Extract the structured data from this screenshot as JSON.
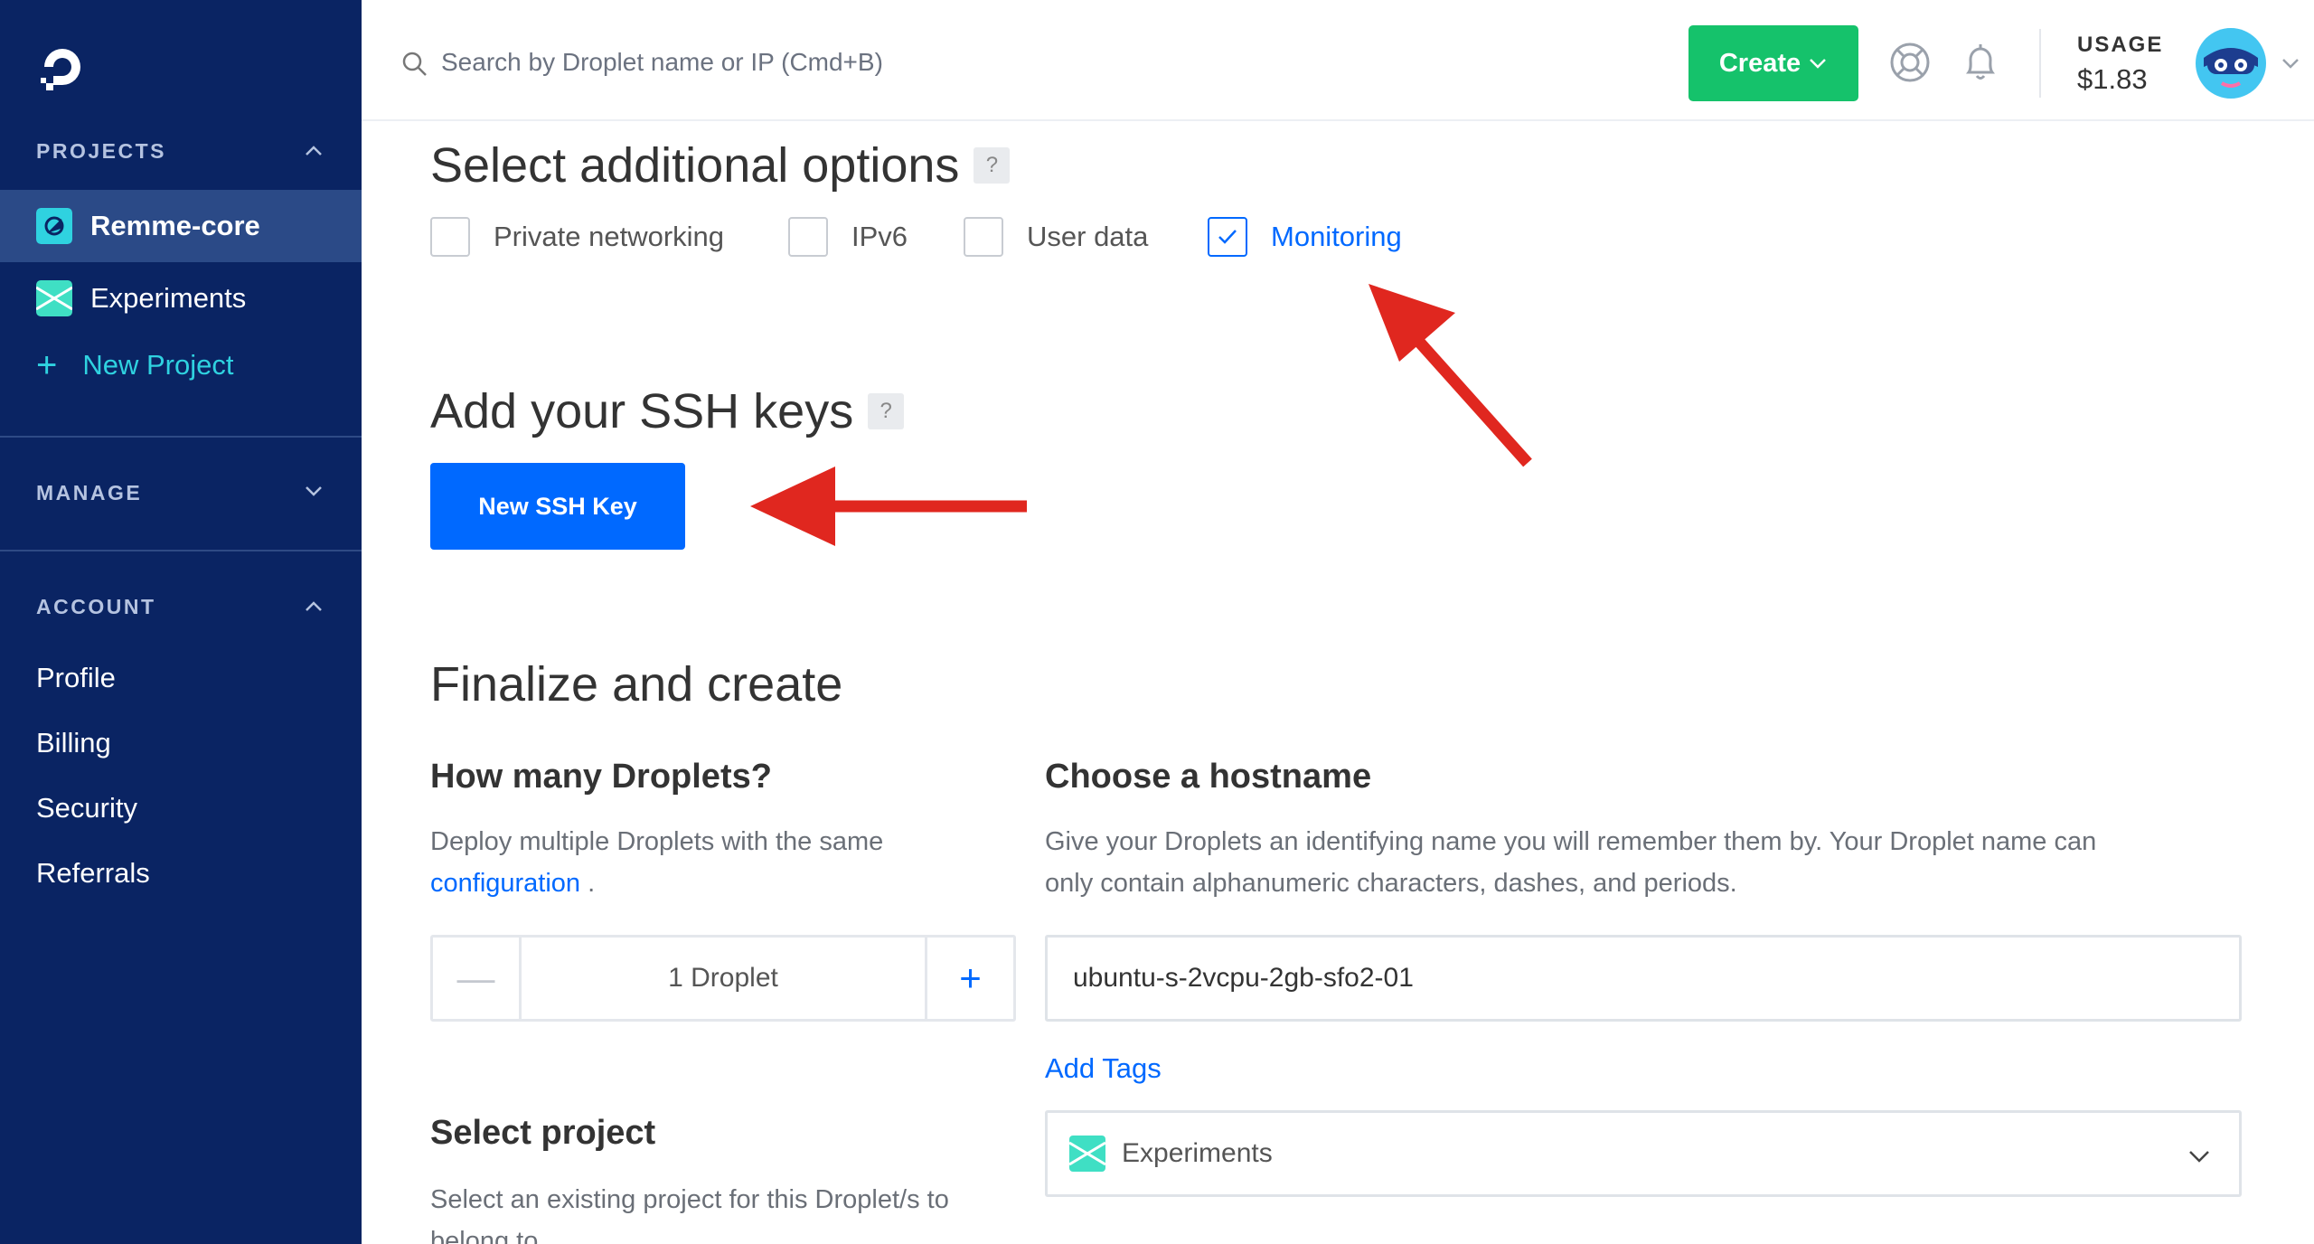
{
  "sidebar": {
    "projects_header": "PROJECTS",
    "projects": [
      {
        "label": "Remme-core",
        "active": true
      },
      {
        "label": "Experiments",
        "active": false
      }
    ],
    "new_project": "New Project",
    "new_project_icon": "plus-icon",
    "manage_header": "MANAGE",
    "account_header": "ACCOUNT",
    "account_items": [
      "Profile",
      "Billing",
      "Security",
      "Referrals"
    ]
  },
  "topbar": {
    "search_placeholder": "Search by Droplet name or IP (Cmd+B)",
    "create_label": "Create",
    "usage_label": "USAGE",
    "usage_value": "$1.83",
    "icons": [
      "search-icon",
      "help-lifebuoy-icon",
      "bell-icon",
      "avatar",
      "chevron-down-icon"
    ]
  },
  "additional_options": {
    "title": "Select additional options",
    "help": "?",
    "options": [
      {
        "label": "Private networking",
        "checked": false
      },
      {
        "label": "IPv6",
        "checked": false
      },
      {
        "label": "User data",
        "checked": false
      },
      {
        "label": "Monitoring",
        "checked": true
      }
    ]
  },
  "ssh": {
    "title": "Add your SSH keys",
    "help": "?",
    "button": "New SSH Key"
  },
  "finalize": {
    "title": "Finalize and create",
    "droplets_heading": "How many Droplets?",
    "droplets_desc": "Deploy multiple Droplets with the same",
    "droplets_link": "configuration",
    "droplets_desc_end": ".",
    "stepper_minus": "—",
    "stepper_value": "1  Droplet",
    "stepper_plus": "+",
    "hostname_heading": "Choose a hostname",
    "hostname_desc_1": "Give your Droplets an identifying name you will remember them by. Your Droplet name can",
    "hostname_desc_2": "only contain alphanumeric characters, dashes, and periods.",
    "hostname_value": "ubuntu-s-2vcpu-2gb-sfo2-01",
    "add_tags": "Add Tags",
    "project_heading": "Select project",
    "project_desc_1": "Select an existing project for this Droplet/s to",
    "project_desc_2": "belong to.",
    "project_selected": "Experiments"
  },
  "colors": {
    "sidebar_bg": "#0a2463",
    "active_item_bg": "#2b4a87",
    "create_green": "#15c26b",
    "primary_blue": "#0069ff",
    "accent_cyan": "#2fd2e0",
    "annotation_red": "#e0271f"
  }
}
